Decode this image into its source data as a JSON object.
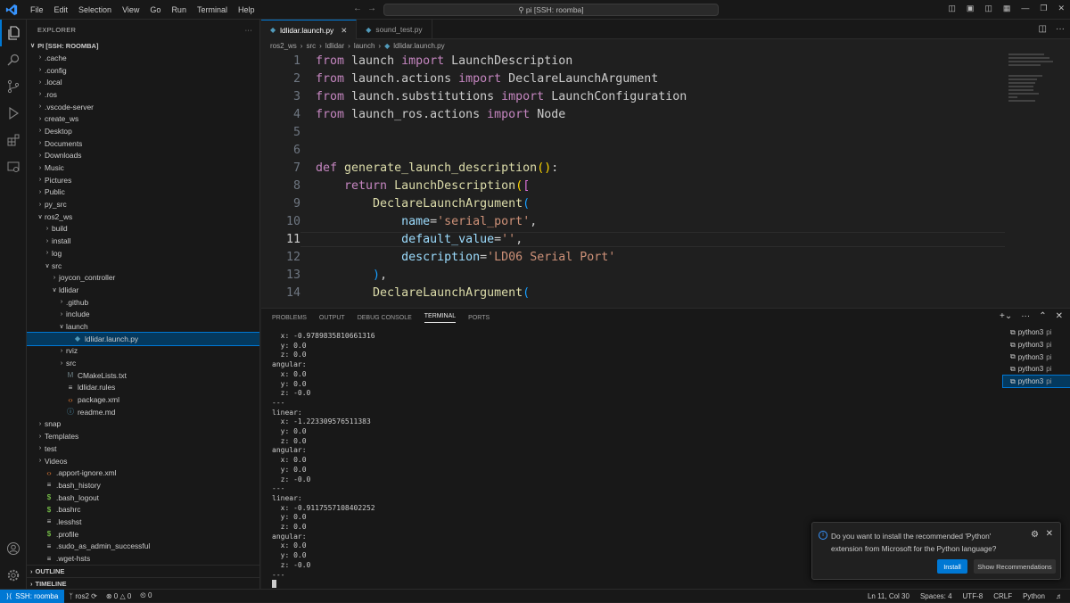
{
  "menu": [
    "File",
    "Edit",
    "Selection",
    "View",
    "Go",
    "Run",
    "Terminal",
    "Help"
  ],
  "command_center": "pi [SSH: roomba]",
  "explorer": {
    "header": "EXPLORER",
    "root": "PI [SSH: ROOMBA]",
    "items": [
      {
        "label": ".cache",
        "depth": 0,
        "type": "folder",
        "open": false
      },
      {
        "label": ".config",
        "depth": 0,
        "type": "folder",
        "open": false
      },
      {
        "label": ".local",
        "depth": 0,
        "type": "folder",
        "open": false
      },
      {
        "label": ".ros",
        "depth": 0,
        "type": "folder",
        "open": false
      },
      {
        "label": ".vscode-server",
        "depth": 0,
        "type": "folder",
        "open": false
      },
      {
        "label": "create_ws",
        "depth": 0,
        "type": "folder",
        "open": false
      },
      {
        "label": "Desktop",
        "depth": 0,
        "type": "folder",
        "open": false
      },
      {
        "label": "Documents",
        "depth": 0,
        "type": "folder",
        "open": false
      },
      {
        "label": "Downloads",
        "depth": 0,
        "type": "folder",
        "open": false
      },
      {
        "label": "Music",
        "depth": 0,
        "type": "folder",
        "open": false
      },
      {
        "label": "Pictures",
        "depth": 0,
        "type": "folder",
        "open": false
      },
      {
        "label": "Public",
        "depth": 0,
        "type": "folder",
        "open": false
      },
      {
        "label": "py_src",
        "depth": 0,
        "type": "folder",
        "open": false
      },
      {
        "label": "ros2_ws",
        "depth": 0,
        "type": "folder",
        "open": true
      },
      {
        "label": "build",
        "depth": 1,
        "type": "folder",
        "open": false
      },
      {
        "label": "install",
        "depth": 1,
        "type": "folder",
        "open": false
      },
      {
        "label": "log",
        "depth": 1,
        "type": "folder",
        "open": false
      },
      {
        "label": "src",
        "depth": 1,
        "type": "folder",
        "open": true
      },
      {
        "label": "joycon_controller",
        "depth": 2,
        "type": "folder",
        "open": false
      },
      {
        "label": "ldlidar",
        "depth": 2,
        "type": "folder",
        "open": true
      },
      {
        "label": ".github",
        "depth": 3,
        "type": "folder",
        "open": false
      },
      {
        "label": "include",
        "depth": 3,
        "type": "folder",
        "open": false
      },
      {
        "label": "launch",
        "depth": 3,
        "type": "folder",
        "open": true
      },
      {
        "label": "ldlidar.launch.py",
        "depth": 4,
        "type": "py",
        "selected": true
      },
      {
        "label": "rviz",
        "depth": 3,
        "type": "folder",
        "open": false
      },
      {
        "label": "src",
        "depth": 3,
        "type": "folder",
        "open": false
      },
      {
        "label": "CMakeLists.txt",
        "depth": 3,
        "type": "cmake"
      },
      {
        "label": "ldlidar.rules",
        "depth": 3,
        "type": "rules"
      },
      {
        "label": "package.xml",
        "depth": 3,
        "type": "xml"
      },
      {
        "label": "readme.md",
        "depth": 3,
        "type": "info"
      },
      {
        "label": "snap",
        "depth": 0,
        "type": "folder",
        "open": false
      },
      {
        "label": "Templates",
        "depth": 0,
        "type": "folder",
        "open": false
      },
      {
        "label": "test",
        "depth": 0,
        "type": "folder",
        "open": false
      },
      {
        "label": "Videos",
        "depth": 0,
        "type": "folder",
        "open": false
      },
      {
        "label": ".apport-ignore.xml",
        "depth": 0,
        "type": "xml"
      },
      {
        "label": ".bash_history",
        "depth": 0,
        "type": "text"
      },
      {
        "label": ".bash_logout",
        "depth": 0,
        "type": "shell"
      },
      {
        "label": ".bashrc",
        "depth": 0,
        "type": "shell"
      },
      {
        "label": ".lesshst",
        "depth": 0,
        "type": "text"
      },
      {
        "label": ".profile",
        "depth": 0,
        "type": "shell"
      },
      {
        "label": ".sudo_as_admin_successful",
        "depth": 0,
        "type": "text"
      },
      {
        "label": ".wget-hsts",
        "depth": 0,
        "type": "text"
      }
    ],
    "outline": "OUTLINE",
    "timeline": "TIMELINE"
  },
  "tabs": [
    {
      "label": "ldlidar.launch.py",
      "active": true
    },
    {
      "label": "sound_test.py",
      "active": false
    }
  ],
  "breadcrumb": [
    "ros2_ws",
    "src",
    "ldlidar",
    "launch",
    "ldlidar.launch.py"
  ],
  "editor": {
    "current_line": 11,
    "lines": [
      [
        [
          "kw",
          "from"
        ],
        [
          "t",
          " launch "
        ],
        [
          "kw",
          "import"
        ],
        [
          "t",
          " LaunchDescription"
        ]
      ],
      [
        [
          "kw",
          "from"
        ],
        [
          "t",
          " launch.actions "
        ],
        [
          "kw",
          "import"
        ],
        [
          "t",
          " DeclareLaunchArgument"
        ]
      ],
      [
        [
          "kw",
          "from"
        ],
        [
          "t",
          " launch.substitutions "
        ],
        [
          "kw",
          "import"
        ],
        [
          "t",
          " LaunchConfiguration"
        ]
      ],
      [
        [
          "kw",
          "from"
        ],
        [
          "t",
          " launch_ros.actions "
        ],
        [
          "kw",
          "import"
        ],
        [
          "t",
          " Node"
        ]
      ],
      [],
      [],
      [
        [
          "kw",
          "def"
        ],
        [
          "t",
          " "
        ],
        [
          "fn",
          "generate_launch_description"
        ],
        [
          "br1",
          "()"
        ],
        [
          "t",
          ":"
        ]
      ],
      [
        [
          "t",
          "    "
        ],
        [
          "kw",
          "return"
        ],
        [
          "t",
          " "
        ],
        [
          "fn",
          "LaunchDescription"
        ],
        [
          "br1",
          "("
        ],
        [
          "br2",
          "["
        ]
      ],
      [
        [
          "t",
          "        "
        ],
        [
          "fn",
          "DeclareLaunchArgument"
        ],
        [
          "br3",
          "("
        ]
      ],
      [
        [
          "t",
          "            "
        ],
        [
          "var",
          "name"
        ],
        [
          "t",
          "="
        ],
        [
          "str",
          "'serial_port'"
        ],
        [
          "t",
          ","
        ]
      ],
      [
        [
          "t",
          "            "
        ],
        [
          "var",
          "default_value"
        ],
        [
          "t",
          "="
        ],
        [
          "str",
          "''"
        ],
        [
          "t",
          ","
        ]
      ],
      [
        [
          "t",
          "            "
        ],
        [
          "var",
          "description"
        ],
        [
          "t",
          "="
        ],
        [
          "str",
          "'LD06 Serial Port'"
        ]
      ],
      [
        [
          "t",
          "        "
        ],
        [
          "br3",
          ")"
        ],
        [
          "t",
          ","
        ]
      ],
      [
        [
          "t",
          "        "
        ],
        [
          "fn",
          "DeclareLaunchArgument"
        ],
        [
          "br3",
          "("
        ]
      ]
    ]
  },
  "panel": {
    "tabs": [
      "PROBLEMS",
      "OUTPUT",
      "DEBUG CONSOLE",
      "TERMINAL",
      "PORTS"
    ],
    "active_tab": "TERMINAL",
    "terminal_lines": [
      "  x: -0.9789835810661316",
      "  y: 0.0",
      "  z: 0.0",
      "angular:",
      "  x: 0.0",
      "  y: 0.0",
      "  z: -0.0",
      "---",
      "linear:",
      "  x: -1.223309576511383",
      "  y: 0.0",
      "  z: 0.0",
      "angular:",
      "  x: 0.0",
      "  y: 0.0",
      "  z: -0.0",
      "---",
      "linear:",
      "  x: -0.9117557108402252",
      "  y: 0.0",
      "  z: 0.0",
      "angular:",
      "  x: 0.0",
      "  y: 0.0",
      "  z: -0.0",
      "---"
    ],
    "terminals": [
      {
        "name": "python3",
        "host": "pi"
      },
      {
        "name": "python3",
        "host": "pi"
      },
      {
        "name": "python3",
        "host": "pi"
      },
      {
        "name": "python3",
        "host": "pi"
      },
      {
        "name": "python3",
        "host": "pi",
        "selected": true
      }
    ]
  },
  "notification": {
    "message": "Do you want to install the recommended 'Python' extension from Microsoft for the Python language?",
    "install": "Install",
    "recommendations": "Show Recommendations"
  },
  "status": {
    "remote": "SSH: roomba",
    "branch": "ros2",
    "errors": "0",
    "warnings": "0",
    "ports": "0",
    "position": "Ln 11, Col 30",
    "spaces": "Spaces: 4",
    "encoding": "UTF-8",
    "eol": "CRLF",
    "language": "Python"
  },
  "colors": {
    "accent": "#0078d4",
    "keyword": "#c586c0",
    "function": "#dcdcaa",
    "string": "#ce9178",
    "variable": "#9cdcfe"
  }
}
